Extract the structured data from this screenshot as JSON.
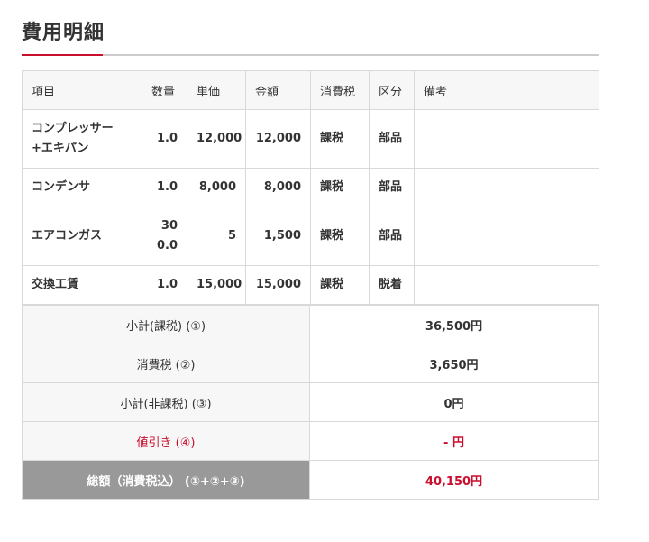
{
  "page": {
    "title": "費用明細"
  },
  "table": {
    "headers": [
      "項目",
      "数量",
      "単価",
      "金額",
      "消費税",
      "区分",
      "備考"
    ],
    "rows": [
      {
        "item": "コンプレッサー+エキパン",
        "qty": "1.0",
        "unit_price": "12,000",
        "amount": "12,000",
        "tax": "課税",
        "category": "部品",
        "note": ""
      },
      {
        "item": "コンデンサ",
        "qty": "1.0",
        "unit_price": "8,000",
        "amount": "8,000",
        "tax": "課税",
        "category": "部品",
        "note": ""
      },
      {
        "item": "エアコンガス",
        "qty": "300.0",
        "unit_price": "5",
        "amount": "1,500",
        "tax": "課税",
        "category": "部品",
        "note": ""
      },
      {
        "item": "交換工賃",
        "qty": "1.0",
        "unit_price": "15,000",
        "amount": "15,000",
        "tax": "課税",
        "category": "脱着",
        "note": ""
      }
    ]
  },
  "summary": {
    "rows": [
      {
        "label": "小計(課税) (①)",
        "value": "36,500円"
      },
      {
        "label": "消費税 (②)",
        "value": "3,650円"
      },
      {
        "label": "小計(非課税) (③)",
        "value": "0円"
      },
      {
        "label": "値引き (④)",
        "value": "- 円"
      },
      {
        "label": "総額（消費税込） (①+②+③)",
        "value": "40,150円"
      }
    ]
  },
  "colors": {
    "accent": "#c8102e",
    "total_bg": "#999999",
    "header_bg": "#f7f7f7"
  }
}
